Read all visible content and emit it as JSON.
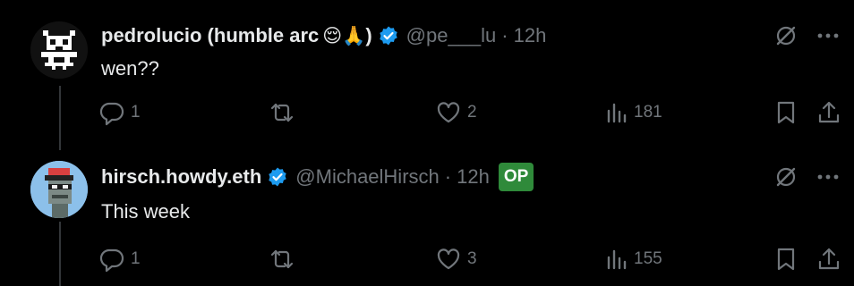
{
  "replies": [
    {
      "display_name": "pedrolucio (humble arc",
      "emoji": "😌🙏",
      "display_name_close": ")",
      "handle": "@pe___lu",
      "separator": "·",
      "time": "12h",
      "op_badge": "",
      "text": "wen??",
      "stats": {
        "replies": "1",
        "retweets": "",
        "likes": "2",
        "views": "181"
      }
    },
    {
      "display_name": "hirsch.howdy.eth",
      "emoji": "",
      "display_name_close": "",
      "handle": "@MichaelHirsch",
      "separator": "·",
      "time": "12h",
      "op_badge": "OP",
      "text": "This week",
      "stats": {
        "replies": "1",
        "retweets": "",
        "likes": "3",
        "views": "155"
      }
    }
  ],
  "colors": {
    "background": "#000000",
    "text": "#e7e9ea",
    "muted": "#71767b",
    "verified": "#1d9bf0",
    "op_badge": "#2f8a3a"
  },
  "icons": [
    "grok-slash-icon",
    "more-icon",
    "reply-icon",
    "retweet-icon",
    "like-icon",
    "views-icon",
    "bookmark-icon",
    "share-icon",
    "verified-badge-icon"
  ]
}
